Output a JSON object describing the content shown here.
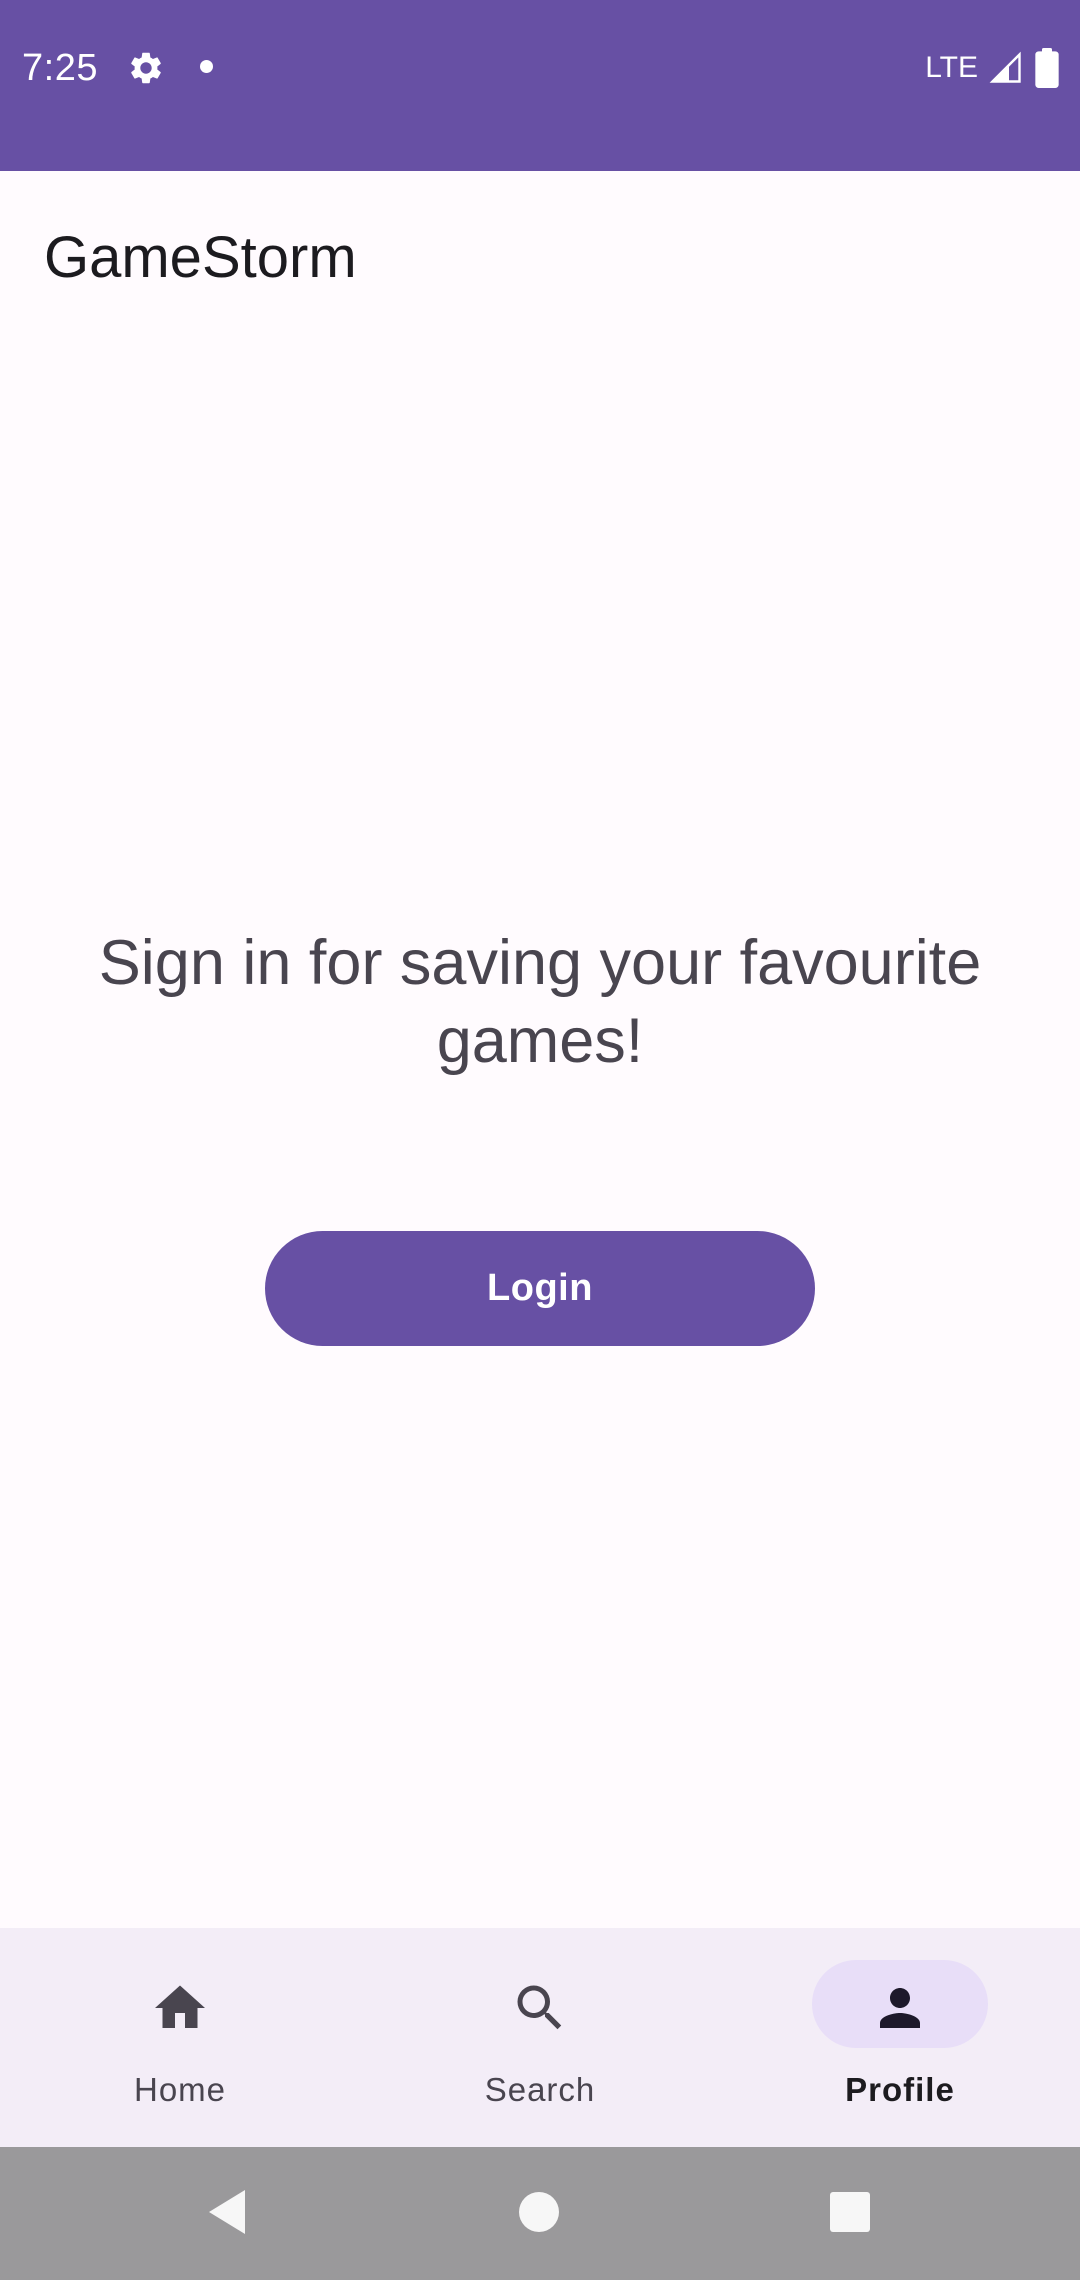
{
  "status_bar": {
    "time": "7:25",
    "network": "LTE",
    "icons": [
      "gear-icon",
      "notification-dot-icon",
      "signal-icon",
      "battery-icon"
    ]
  },
  "app": {
    "title": "GameStorm"
  },
  "main": {
    "prompt": "Sign in for saving your favourite games!",
    "login_label": "Login"
  },
  "bottom_nav": {
    "items": [
      {
        "label": "Home",
        "icon": "home-icon",
        "active": false
      },
      {
        "label": "Search",
        "icon": "search-icon",
        "active": false
      },
      {
        "label": "Profile",
        "icon": "person-icon",
        "active": true
      }
    ]
  },
  "system_nav": {
    "icons": [
      "back-icon",
      "home-circle-icon",
      "recents-icon"
    ]
  },
  "colors": {
    "primary": "#6750A4",
    "background": "#FFFBFE",
    "nav_background": "#F3EDF7",
    "active_indicator": "#E8DEF8",
    "system_nav": "#9A999B",
    "text_primary": "#1C1B1F",
    "text_secondary": "#49454F"
  }
}
